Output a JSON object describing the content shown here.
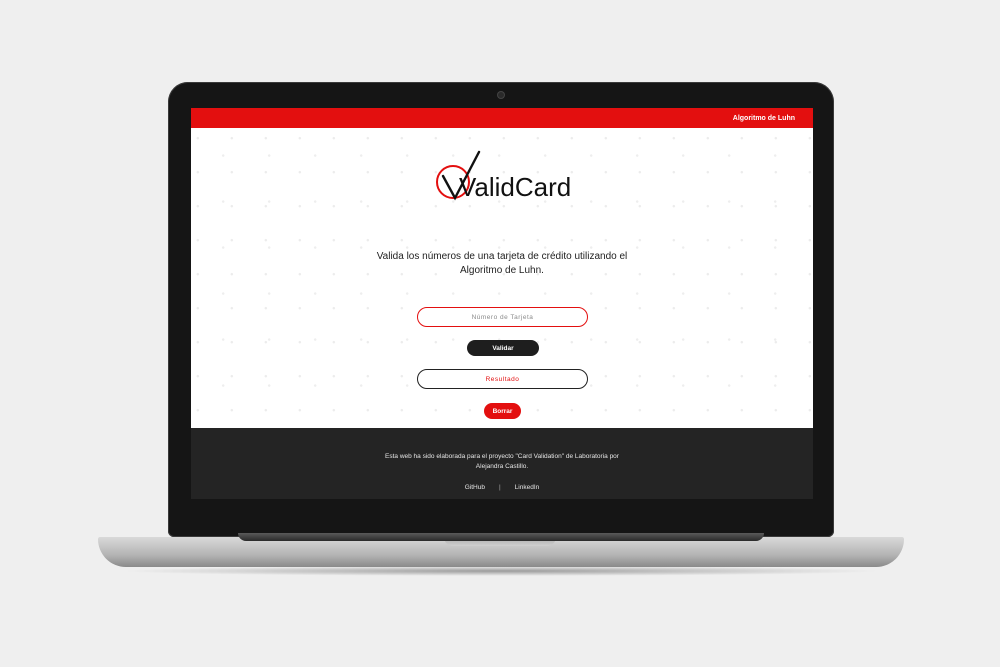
{
  "header": {
    "nav_label": "Algoritmo de Luhn"
  },
  "logo": {
    "text": "ValidCard"
  },
  "main": {
    "description": "Valida los números de una tarjeta de crédito utilizando el Algoritmo de Luhn.",
    "card_input_placeholder": "Número de Tarjeta",
    "validate_label": "Validar",
    "result_placeholder": "Resultado",
    "clear_label": "Borrar"
  },
  "footer": {
    "text": "Esta web ha sido elaborada para el proyecto \"Card Validation\" de Laboratoria por Alejandra Castillo.",
    "links": [
      "GitHub",
      "LinkedIn"
    ],
    "separator": "|"
  },
  "colors": {
    "accent": "#e30f0f",
    "dark": "#242424"
  },
  "icons": [
    "checkmark-logo-icon",
    "camera-icon"
  ]
}
